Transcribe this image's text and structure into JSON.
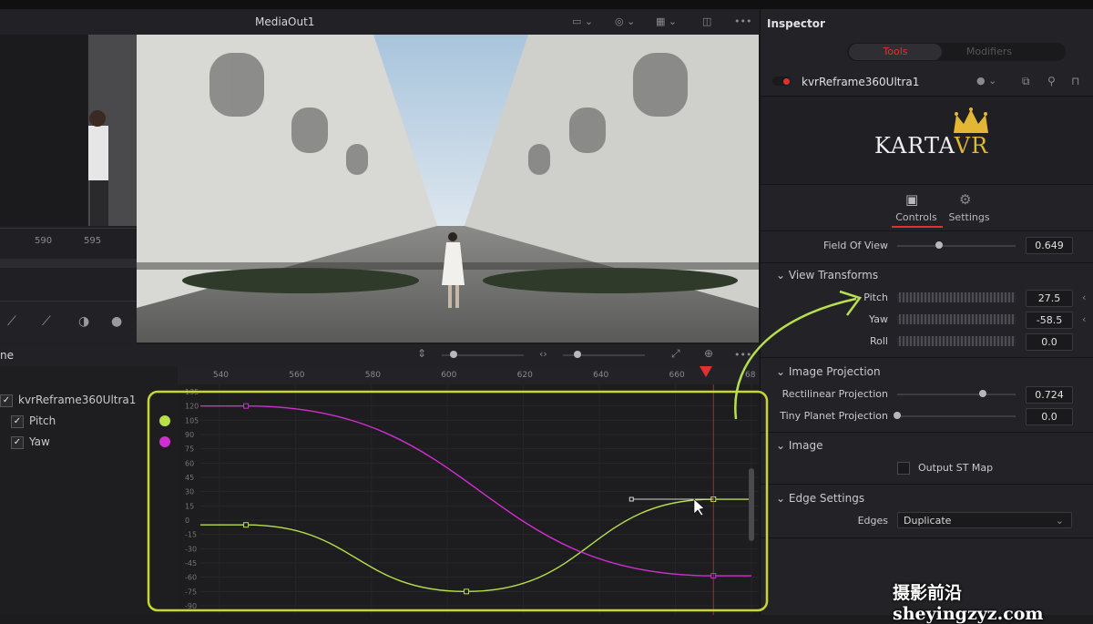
{
  "viewer": {
    "title": "MediaOut1",
    "menu_label": "•••"
  },
  "left_panel": {
    "ruler_labels": [
      "590",
      "595"
    ]
  },
  "spline": {
    "title": "ne",
    "menu_label": "•••",
    "tree": {
      "node": "kvrReframe360Ultra1",
      "channels": [
        "Pitch",
        "Yaw"
      ]
    },
    "ruler": [
      "540",
      "560",
      "580",
      "600",
      "620",
      "640",
      "660",
      "68"
    ],
    "y_ticks": [
      "135",
      "120",
      "105",
      "90",
      "75",
      "60",
      "45",
      "30",
      "15",
      "0",
      "-15",
      "-30",
      "-45",
      "-60",
      "-75",
      "-90"
    ],
    "colors": {
      "pitch": "#b8e04a",
      "yaw": "#cf2fcf",
      "playhead": "#e03030",
      "highlight": "#c7d633"
    }
  },
  "chart_data": {
    "type": "line",
    "xlim": [
      535,
      680
    ],
    "ylim": [
      -90,
      135
    ],
    "series": [
      {
        "name": "Pitch",
        "color": "#b8e04a",
        "points": [
          [
            535,
            -5
          ],
          [
            547,
            -5
          ],
          [
            605,
            -75
          ],
          [
            670,
            22
          ],
          [
            680,
            22
          ]
        ],
        "keyframes": [
          [
            547,
            -5
          ],
          [
            605,
            -75
          ],
          [
            670,
            22
          ]
        ]
      },
      {
        "name": "Yaw",
        "color": "#cf2fcf",
        "points": [
          [
            535,
            120
          ],
          [
            547,
            120
          ],
          [
            670,
            -58.5
          ],
          [
            680,
            -58.5
          ]
        ],
        "keyframes": [
          [
            547,
            120
          ],
          [
            670,
            -58.5
          ]
        ]
      }
    ],
    "playhead": 670
  },
  "inspector": {
    "title": "Inspector",
    "tabs": [
      "Tools",
      "Modifiers"
    ],
    "node_name": "kvrReframe360Ultra1",
    "logo": {
      "main": "KARTA",
      "accent": "VR"
    },
    "control_tabs": [
      "Controls",
      "Settings"
    ],
    "field_of_view": {
      "label": "Field Of View",
      "value": "0.649",
      "fraction": 0.35
    },
    "view_transforms": {
      "title": "View Transforms",
      "pitch": {
        "label": "Pitch",
        "value": "27.5"
      },
      "yaw": {
        "label": "Yaw",
        "value": "-58.5"
      },
      "roll": {
        "label": "Roll",
        "value": "0.0"
      }
    },
    "image_projection": {
      "title": "Image Projection",
      "rectilinear": {
        "label": "Rectilinear Projection",
        "value": "0.724",
        "fraction": 0.724
      },
      "tiny_planet": {
        "label": "Tiny Planet Projection",
        "value": "0.0",
        "fraction": 0.0
      }
    },
    "image": {
      "title": "Image",
      "checkbox_label": "Output ST Map"
    },
    "edge_settings": {
      "title": "Edge Settings",
      "edges_label": "Edges",
      "edges_value": "Duplicate"
    }
  },
  "watermark": "摄影前沿 sheyingzyz.com"
}
